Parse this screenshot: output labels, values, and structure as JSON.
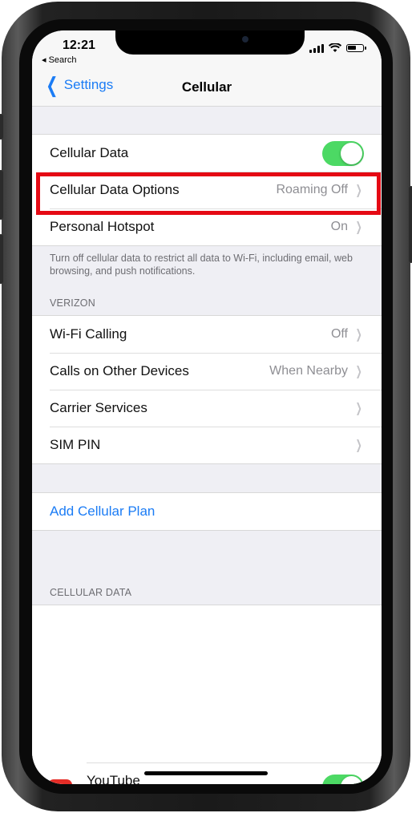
{
  "status_bar": {
    "time": "12:21",
    "back_app": "◂ Search"
  },
  "nav": {
    "back_label": "Settings",
    "title": "Cellular"
  },
  "group1": {
    "rows": [
      {
        "label": "Cellular Data",
        "toggle_on": true
      },
      {
        "label": "Cellular Data Options",
        "value": "Roaming Off"
      },
      {
        "label": "Personal Hotspot",
        "value": "On"
      }
    ],
    "footnote": "Turn off cellular data to restrict all data to Wi-Fi, including email, web browsing, and push notifications."
  },
  "carrier_section": {
    "header": "VERIZON",
    "rows": [
      {
        "label": "Wi-Fi Calling",
        "value": "Off"
      },
      {
        "label": "Calls on Other Devices",
        "value": "When Nearby"
      },
      {
        "label": "Carrier Services",
        "value": ""
      },
      {
        "label": "SIM PIN",
        "value": ""
      }
    ]
  },
  "plan": {
    "add_label": "Add Cellular Plan"
  },
  "cellular_data_section": {
    "header": "CELLULAR DATA",
    "apps": [
      {
        "label": "YouTube",
        "toggle_on": true
      }
    ]
  },
  "colors": {
    "accent": "#1b7cf5",
    "toggle_on": "#4cd964",
    "highlight": "#e50914"
  }
}
